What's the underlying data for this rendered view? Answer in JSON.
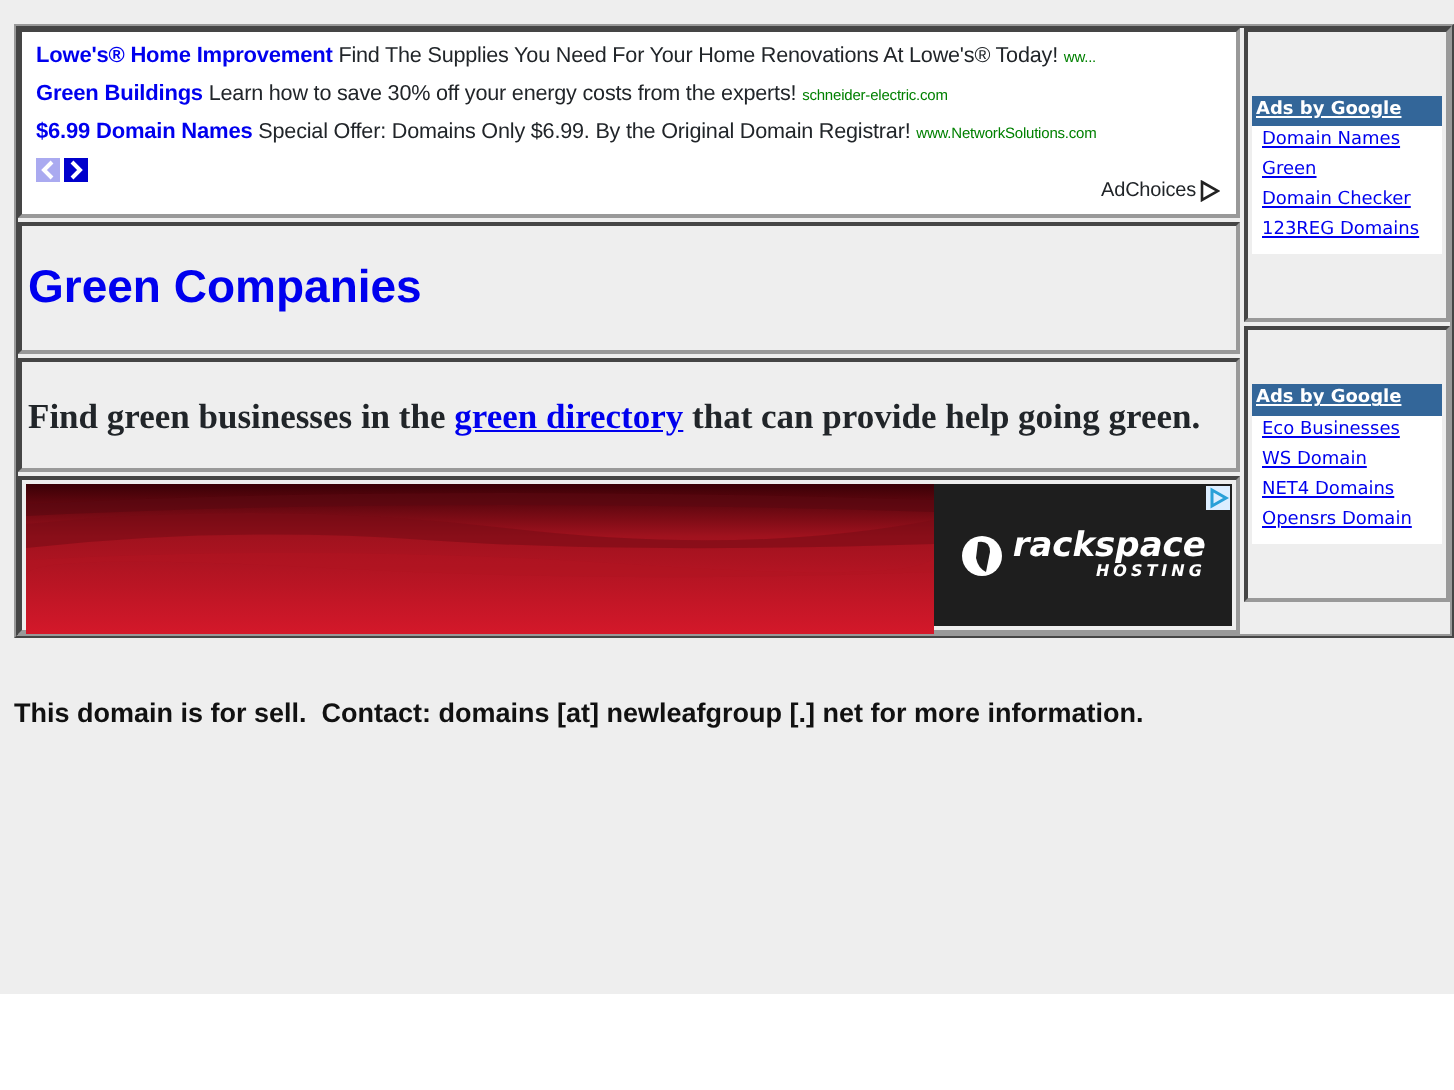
{
  "text_ads": [
    {
      "title": "Lowe's® Home Improvement",
      "text": "Find The Supplies You Need For Your Home Renovations At Lowe's® Today!",
      "url": "ww..."
    },
    {
      "title": "Green Buildings",
      "text": "Learn how to save 30% off your energy costs from the experts!",
      "url": "schneider-electric.com"
    },
    {
      "title": "$6.99 Domain Names",
      "text": "Special Offer: Domains Only $6.99. By the Original Domain Registrar!",
      "url": "www.NetworkSolutions.com"
    }
  ],
  "ad_nav": {
    "prev_disabled": true,
    "next_disabled": false
  },
  "adchoices": "AdChoices",
  "heading": "Green Companies",
  "intro": {
    "before": "Find green businesses in the",
    "link": "green directory",
    "after": "that can provide help going green."
  },
  "banner": {
    "brand": "rackspace",
    "tagline": "HOSTING"
  },
  "link_units": [
    {
      "header": "Ads by Google",
      "links": [
        "Domain Names",
        "Green",
        "Domain Checker",
        "123REG Domains"
      ]
    },
    {
      "header": "Ads by Google",
      "links": [
        "Eco Businesses",
        "WS Domain",
        "NET4 Domains",
        "Opensrs Domain"
      ]
    }
  ],
  "footer_note": "This domain is for sell.  Contact: domains [at] newleafgroup [.] net for more information."
}
